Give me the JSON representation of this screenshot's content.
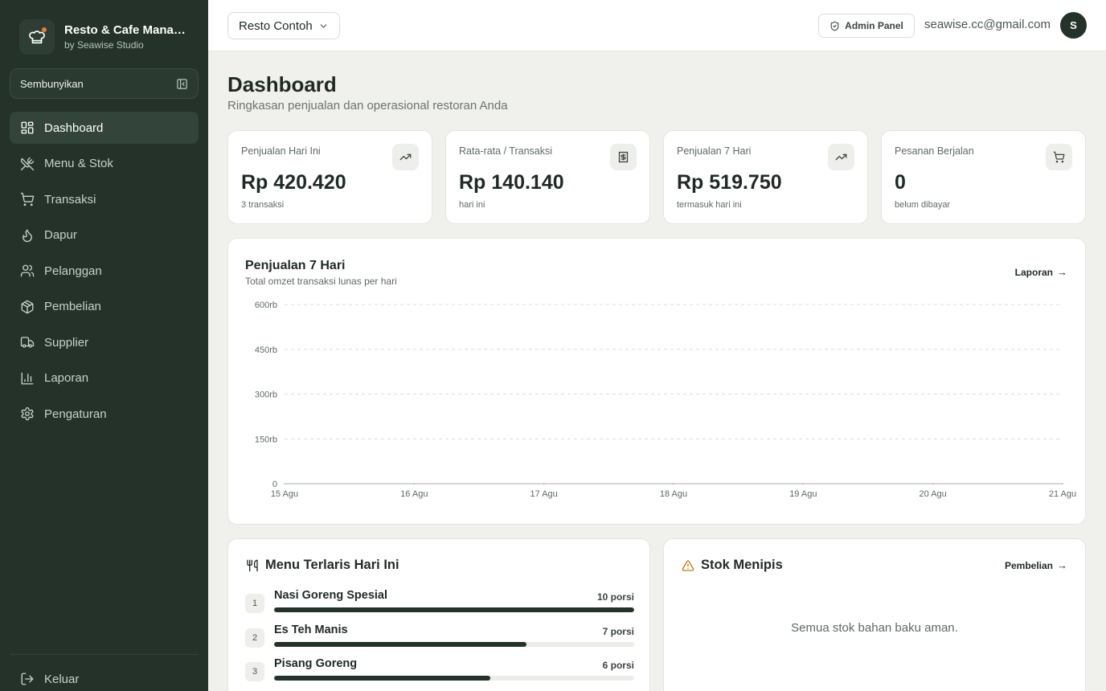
{
  "brand": {
    "title": "Resto & Cafe Management",
    "subtitle": "by Seawise Studio"
  },
  "sidebar": {
    "hide_label": "Sembunyikan",
    "items": [
      {
        "label": "Dashboard",
        "icon": "dashboard-icon",
        "active": true
      },
      {
        "label": "Menu & Stok",
        "icon": "utensils-crossed-icon"
      },
      {
        "label": "Transaksi",
        "icon": "cart-icon"
      },
      {
        "label": "Dapur",
        "icon": "flame-icon"
      },
      {
        "label": "Pelanggan",
        "icon": "users-icon"
      },
      {
        "label": "Pembelian",
        "icon": "package-icon"
      },
      {
        "label": "Supplier",
        "icon": "truck-icon"
      },
      {
        "label": "Laporan",
        "icon": "bar-chart-icon"
      },
      {
        "label": "Pengaturan",
        "icon": "gear-icon"
      }
    ],
    "logout_label": "Keluar"
  },
  "topbar": {
    "restaurant": "Resto Contoh",
    "admin_label": "Admin Panel",
    "email": "seawise.cc@gmail.com",
    "avatar_initial": "S"
  },
  "page": {
    "title": "Dashboard",
    "subtitle": "Ringkasan penjualan dan operasional restoran Anda"
  },
  "stats": [
    {
      "label": "Penjualan Hari Ini",
      "value": "Rp 420.420",
      "note": "3 transaksi",
      "icon": "trending-up-icon"
    },
    {
      "label": "Rata-rata / Transaksi",
      "value": "Rp 140.140",
      "note": "hari ini",
      "icon": "receipt-icon"
    },
    {
      "label": "Penjualan 7 Hari",
      "value": "Rp 519.750",
      "note": "termasuk hari ini",
      "icon": "trending-up-icon"
    },
    {
      "label": "Pesanan Berjalan",
      "value": "0",
      "note": "belum dibayar",
      "icon": "cart-icon"
    }
  ],
  "sales_card": {
    "title": "Penjualan 7 Hari",
    "subtitle": "Total omzet transaksi lunas per hari",
    "link": "Laporan"
  },
  "chart_data": {
    "type": "line",
    "title": "Penjualan 7 Hari",
    "x": [
      "15 Agu",
      "16 Agu",
      "17 Agu",
      "18 Agu",
      "19 Agu",
      "20 Agu",
      "21 Agu"
    ],
    "values": [
      0,
      0,
      0,
      0,
      0,
      0,
      0
    ],
    "y_ticks": [
      "0",
      "150rb",
      "300rb",
      "450rb",
      "600rb"
    ],
    "ylim": [
      0,
      600000
    ],
    "grid": true,
    "colors": {
      "line": "#243229",
      "grid": "#dcdcd6"
    }
  },
  "menu_card": {
    "title": "Menu Terlaris Hari Ini",
    "items": [
      {
        "rank": "1",
        "name": "Nasi Goreng Spesial",
        "qty": "10 porsi",
        "fraction": 1.0
      },
      {
        "rank": "2",
        "name": "Es Teh Manis",
        "qty": "7 porsi",
        "fraction": 0.7
      },
      {
        "rank": "3",
        "name": "Pisang Goreng",
        "qty": "6 porsi",
        "fraction": 0.6
      }
    ]
  },
  "stock_card": {
    "title": "Stok Menipis",
    "link": "Pembelian",
    "empty_text": "Semua stok bahan baku aman."
  }
}
